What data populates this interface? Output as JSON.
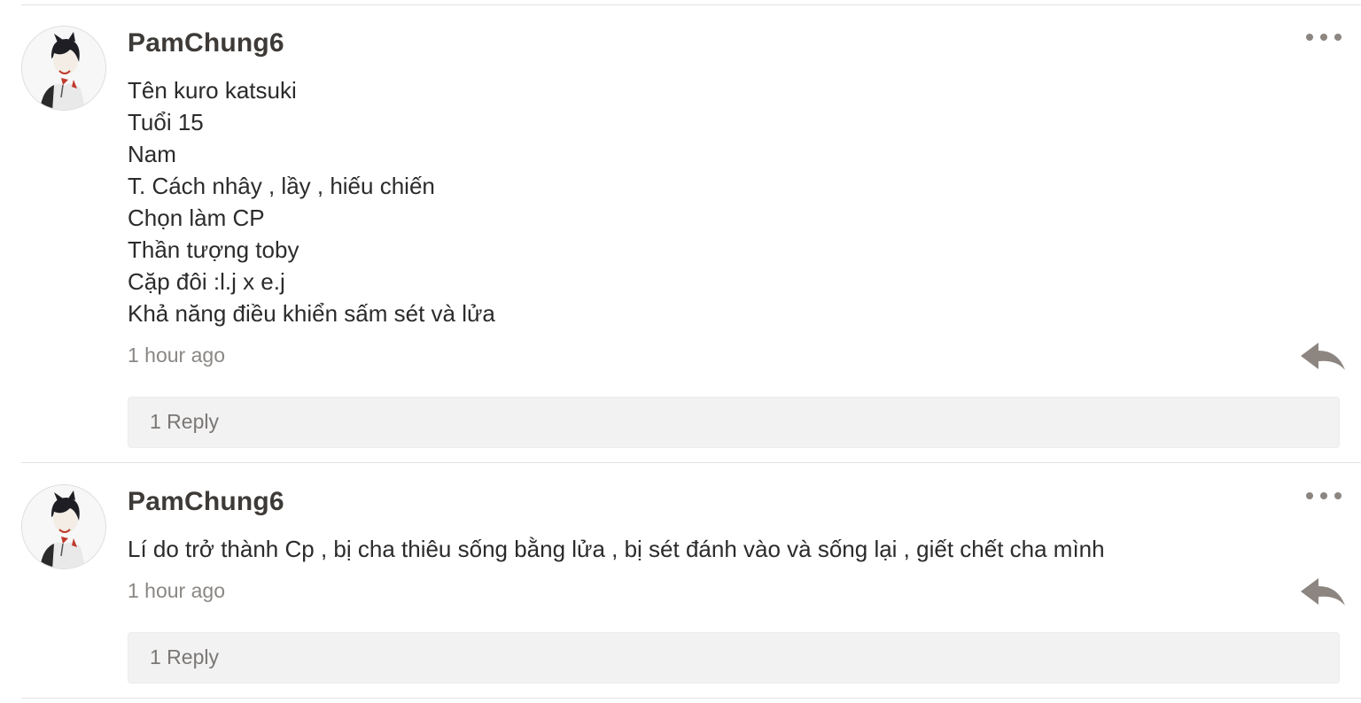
{
  "comments": [
    {
      "username": "PamChung6",
      "body_lines": [
        "Tên kuro katsuki",
        "Tuổi 15",
        "Nam",
        "T. Cách nhây , lầy , hiếu chiến",
        "Chọn làm CP",
        "Thần tượng toby",
        "Cặp đôi :l.j x e.j",
        "Khả năng điều khiển sấm sét và lửa"
      ],
      "time": "1 hour ago",
      "replies_label": "1 Reply",
      "more_icon": "more-horizontal-icon",
      "reply_icon": "reply-arrow-icon",
      "avatar": "anime-character-avatar"
    },
    {
      "username": "PamChung6",
      "body_lines": [
        "Lí do trở thành Cp , bị cha thiêu sống bằng lửa , bị sét đánh vào và sống lại , giết chết cha mình"
      ],
      "time": "1 hour ago",
      "replies_label": "1 Reply",
      "more_icon": "more-horizontal-icon",
      "reply_icon": "reply-arrow-icon",
      "avatar": "anime-character-avatar"
    }
  ],
  "colors": {
    "username": "#3d3a37",
    "body_text": "#2b2b2b",
    "meta_text": "#8a8784",
    "icon": "#8c8580",
    "replies_bg": "#f2f2f2",
    "divider": "#e2e2e2"
  }
}
